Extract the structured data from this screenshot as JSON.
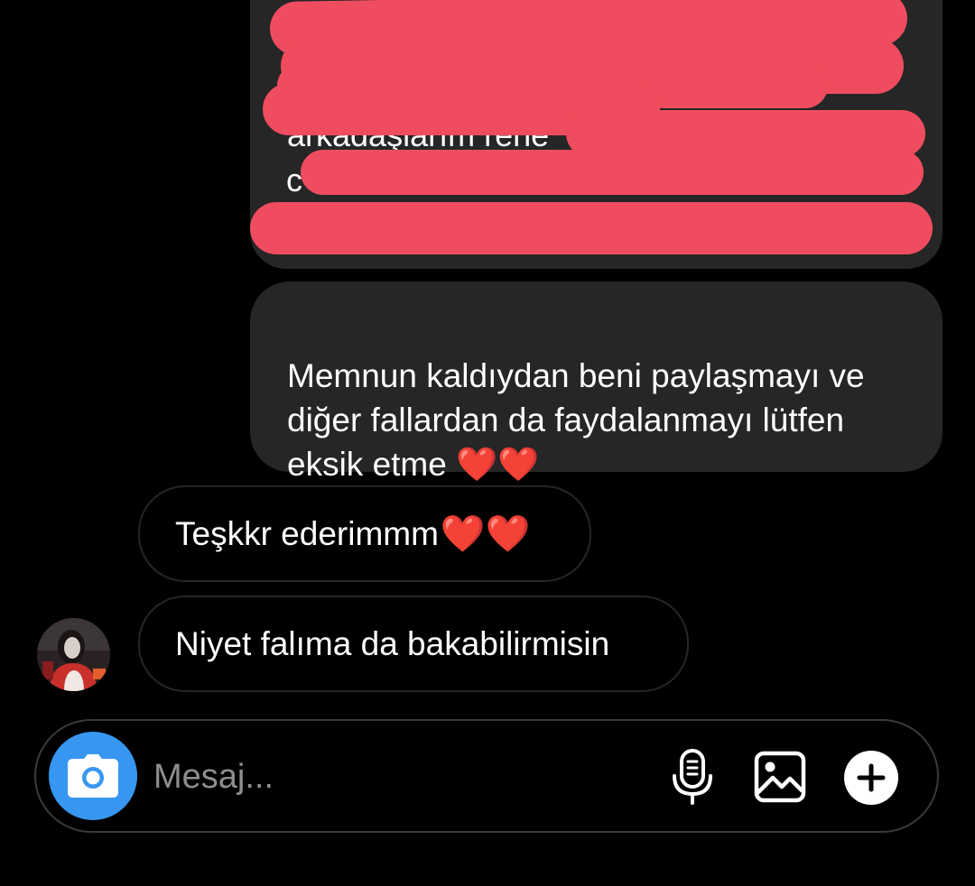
{
  "thread": {
    "redacted_message": {
      "partial_line_1": "arkadaşlarım rene",
      "partial_line_2": "c"
    },
    "outgoing_message": {
      "text": "Memnun kaldıydan beni paylaşmayı ve\ndiğer fallardan da faydalanmayı lütfen\neksik etme ❤️❤️"
    },
    "incoming_messages": [
      {
        "text": "Teşkkr ederimmm",
        "emoji": "❤️❤️"
      },
      {
        "text": "Niyet falıma da bakabilirmisin"
      }
    ]
  },
  "composer": {
    "placeholder": "Mesaj...",
    "icons": {
      "camera": "camera-icon",
      "microphone": "microphone-icon",
      "gallery": "gallery-icon",
      "add": "plus-icon"
    }
  },
  "colors": {
    "background": "#000000",
    "outgoing_bubble": "#262626",
    "incoming_bubble_border": "#262626",
    "redaction": "#ef4d5f",
    "camera_button": "#3797f0",
    "heart": "#e0131b",
    "placeholder": "#8e8e8e"
  }
}
